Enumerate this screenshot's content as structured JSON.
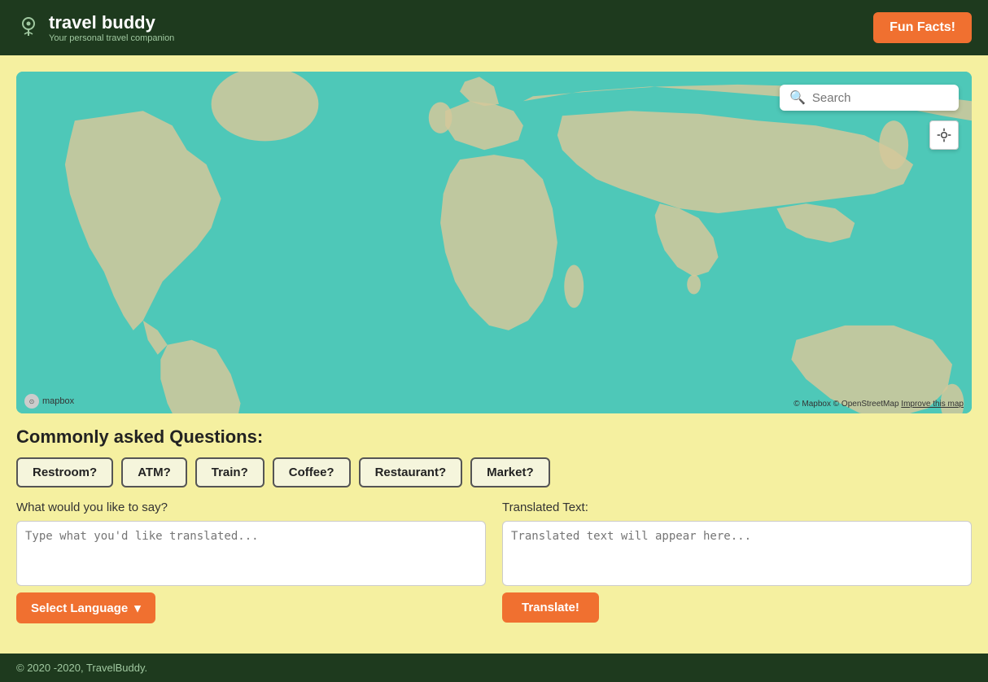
{
  "header": {
    "logo_title": "travel buddy",
    "logo_subtitle": "Your personal travel companion",
    "fun_facts_label": "Fun Facts!"
  },
  "map": {
    "search_placeholder": "Search",
    "attribution": "© Mapbox © OpenStreetMap",
    "improve_link": "Improve this map",
    "mapbox_label": "mapbox"
  },
  "questions": {
    "heading": "Commonly asked Questions:",
    "buttons": [
      "Restroom?",
      "ATM?",
      "Train?",
      "Coffee?",
      "Restaurant?",
      "Market?"
    ]
  },
  "translation": {
    "input_label": "What would you like to say?",
    "input_placeholder": "Type what you'd like translated...",
    "output_label": "Translated Text:",
    "output_placeholder": "Translated text will appear here...",
    "select_language_label": "Select Language",
    "translate_label": "Translate!"
  },
  "footer": {
    "text": "© 2020 -2020, TravelBuddy."
  }
}
